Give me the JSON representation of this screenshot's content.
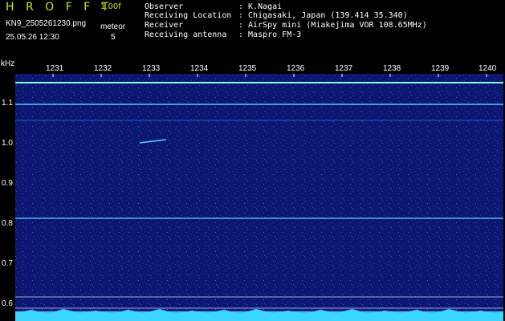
{
  "header": {
    "app_title": "H R O F F T",
    "version": "1.00f",
    "filename": "KN9_2505261230.png",
    "datetime": "25.05.26 12:30",
    "meteor_label": "meteor",
    "meteor_count": "5"
  },
  "info": [
    {
      "key": "Observer",
      "value": ": K.Nagai"
    },
    {
      "key": "Receiving Location",
      "value": ": Chigasaki, Japan (139.414 35.340)"
    },
    {
      "key": "Receiver",
      "value": ": AirSpy mini (Miakejima VOR 108.65MHz)"
    },
    {
      "key": "Receiving antenna",
      "value": ": Maspro FM-3"
    }
  ],
  "axes": {
    "y_unit": "kHz",
    "y_ticks": [
      "1.1",
      "1.0",
      "0.9",
      "0.8",
      "0.7",
      "0.6"
    ],
    "x_ticks": [
      "1231",
      "1232",
      "1233",
      "1234",
      "1235",
      "1236",
      "1237",
      "1238",
      "1239",
      "1240"
    ]
  },
  "colors": {
    "background": "#000000",
    "title_accent": "#c8e61e",
    "noise_floor": "#0b1a73",
    "signal_line": "#3fb3ff",
    "carrier": "#7fffd0"
  }
}
